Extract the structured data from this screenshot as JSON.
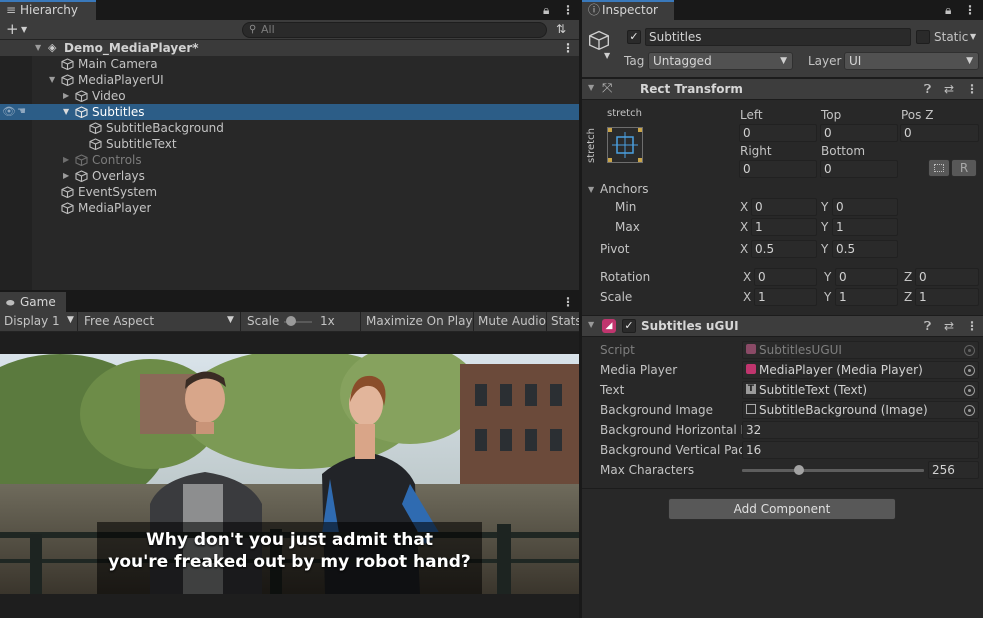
{
  "hierarchy": {
    "tab_label": "Hierarchy",
    "search_placeholder": "All",
    "scene_name": "Demo_MediaPlayer*",
    "items": [
      {
        "label": "Main Camera"
      },
      {
        "label": "MediaPlayerUI"
      },
      {
        "label": "Video"
      },
      {
        "label": "Subtitles"
      },
      {
        "label": "SubtitleBackground"
      },
      {
        "label": "SubtitleText"
      },
      {
        "label": "Controls"
      },
      {
        "label": "Overlays"
      },
      {
        "label": "EventSystem"
      },
      {
        "label": "MediaPlayer"
      }
    ]
  },
  "game": {
    "tab_label": "Game",
    "display": "Display 1",
    "aspect": "Free Aspect",
    "scale_label": "Scale",
    "scale_value": "1x",
    "scale_level": 0.1,
    "maximize": "Maximize On Play",
    "mute": "Mute Audio",
    "stats": "Stats",
    "subtitle_line1": "Why don't you just admit that",
    "subtitle_line2": "you're freaked out by my robot hand?"
  },
  "inspector": {
    "tab_label": "Inspector",
    "object_name": "Subtitles",
    "static_label": "Static",
    "tag_label": "Tag",
    "tag_value": "Untagged",
    "layer_label": "Layer",
    "layer_value": "UI",
    "rect_transform": {
      "title": "Rect Transform",
      "preset_label": "stretch",
      "preset_side_label": "stretch",
      "left_label": "Left",
      "left": "0",
      "top_label": "Top",
      "top": "0",
      "posz_label": "Pos Z",
      "posz": "0",
      "right_label": "Right",
      "right": "0",
      "bottom_label": "Bottom",
      "bottom": "0",
      "r_button": "R",
      "anchors_label": "Anchors",
      "min_label": "Min",
      "min_x": "0",
      "min_y": "0",
      "max_label": "Max",
      "max_x": "1",
      "max_y": "1",
      "pivot_label": "Pivot",
      "pivot_x": "0.5",
      "pivot_y": "0.5",
      "rotation_label": "Rotation",
      "rot_x": "0",
      "rot_y": "0",
      "rot_z": "0",
      "scale_label": "Scale",
      "scale_x": "1",
      "scale_y": "1",
      "scale_z": "1",
      "x": "X",
      "y": "Y",
      "z": "Z"
    },
    "subtitles_ugui": {
      "title": "Subtitles uGUI",
      "script_label": "Script",
      "script_value": "SubtitlesUGUI",
      "media_player_label": "Media Player",
      "media_player_value": "MediaPlayer (Media Player)",
      "text_label": "Text",
      "text_value": "SubtitleText (Text)",
      "bg_image_label": "Background Image",
      "bg_image_value": "SubtitleBackground (Image)",
      "bg_h_pad_label": "Background Horizontal P",
      "bg_h_pad_value": "32",
      "bg_v_pad_label": "Background Vertical Pad",
      "bg_v_pad_value": "16",
      "max_chars_label": "Max Characters",
      "max_chars_value": "256",
      "max_chars_level": 0.3
    },
    "add_component": "Add Component"
  },
  "colors": {
    "selection": "#2c5d87",
    "tab_accent": "#3a79bb",
    "panel": "#282828",
    "field": "#2a2a2a"
  }
}
